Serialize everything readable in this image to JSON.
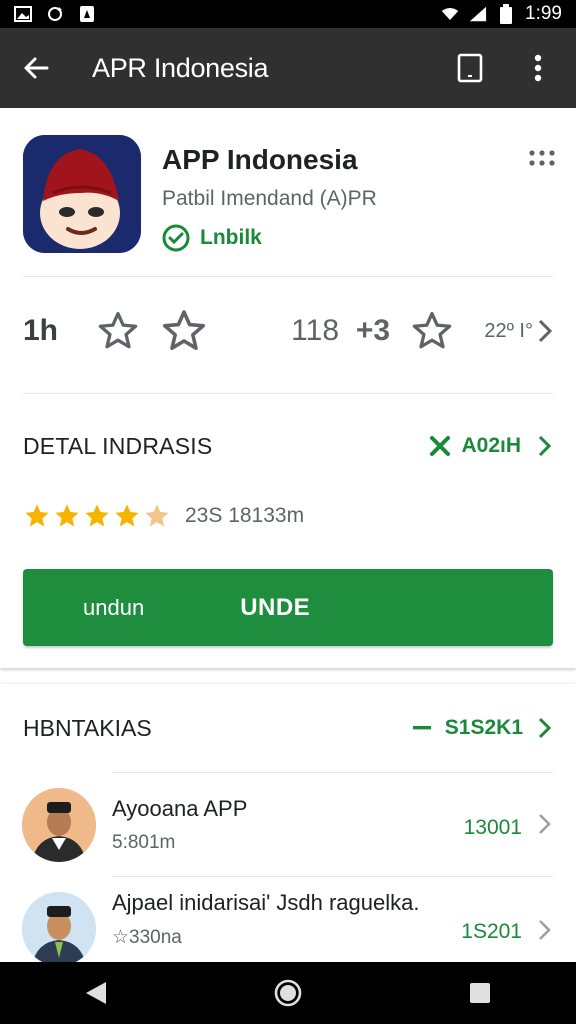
{
  "status_bar": {
    "time": "1:99",
    "icons": [
      "image-icon",
      "sync-icon",
      "notification-icon",
      "wifi-icon",
      "signal-icon",
      "battery-icon"
    ]
  },
  "toolbar": {
    "title": "APR Indonesia",
    "icons": [
      "back-arrow-icon",
      "tablet-icon",
      "overflow-menu-icon"
    ]
  },
  "app": {
    "name": "APP Indonesia",
    "subtitle": "Patbil Imendand (A)PR",
    "badge_label": "Lnbilk",
    "icon_name": "app-mascot-icon"
  },
  "stats": {
    "left_value": "1h",
    "mid_value": "118",
    "plus_value": "+3",
    "right_value": "22º I°"
  },
  "details": {
    "title": "DETAL INDRASIS",
    "link_label": "A02ıH"
  },
  "rating": {
    "value": 4.5,
    "max": 5,
    "text": "23S 18133m"
  },
  "install": {
    "left_label": "undun",
    "main_label": "UNDE"
  },
  "section": {
    "title": "HBNTAKIAS",
    "link_label": "S1S2K1"
  },
  "list": [
    {
      "title": "Ayooana APP",
      "subtitle": "5:801m",
      "value": "13001"
    },
    {
      "title": "Ajpael inidarisai' Jsdh raguelka.",
      "subtitle": "☆330na",
      "value": "1S201"
    }
  ],
  "colors": {
    "accent": "#1e8e3e",
    "toolbar": "#303030",
    "star": "#f4b400"
  }
}
